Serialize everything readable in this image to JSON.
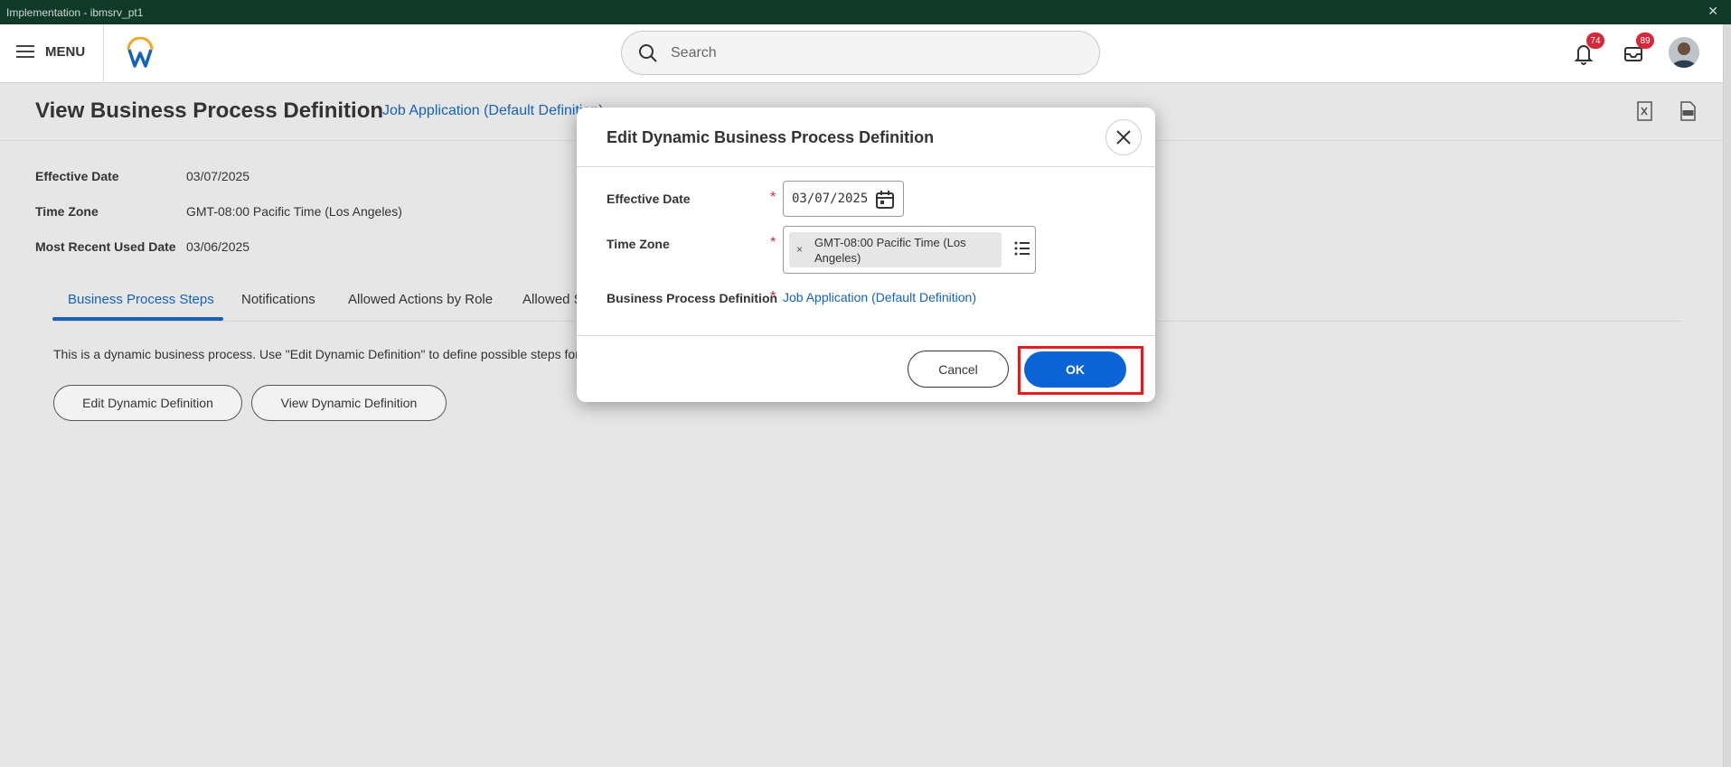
{
  "window": {
    "title": "Implementation - ibmsrv_pt1"
  },
  "topnav": {
    "menu_label": "MENU",
    "search_placeholder": "Search",
    "notifications_count": "74",
    "inbox_count": "89"
  },
  "page": {
    "title": "View Business Process Definition",
    "bp_link": "Job Application (Default Definition)",
    "fields": [
      {
        "label": "Effective Date",
        "value": "03/07/2025"
      },
      {
        "label": "Time Zone",
        "value": "GMT-08:00 Pacific Time (Los Angeles)"
      },
      {
        "label": "Most Recent Used Date",
        "value": "03/06/2025"
      }
    ],
    "tabs": [
      "Business Process Steps",
      "Notifications",
      "Allowed Actions by Role",
      "Allowed S"
    ],
    "description": "This is a dynamic business process.  Use \"Edit Dynamic Definition\" to define possible steps for",
    "buttons": {
      "edit": "Edit Dynamic Definition",
      "view": "View Dynamic Definition"
    }
  },
  "modal": {
    "title": "Edit Dynamic Business Process Definition",
    "effective_date_label": "Effective Date",
    "effective_date_value": "03/07/2025",
    "time_zone_label": "Time Zone",
    "time_zone_value": "GMT-08:00 Pacific Time (Los Angeles)",
    "bp_label": "Business Process Definition",
    "bp_value": "Job Application (Default Definition)",
    "required_mark": "*",
    "remove_mark": "×",
    "cancel_label": "Cancel",
    "ok_label": "OK"
  },
  "colors": {
    "accent": "#0a64d6",
    "link": "#1762b6",
    "required": "#d6283a",
    "highlight": "#e11d1d",
    "titlebar": "#0f3a2a"
  }
}
